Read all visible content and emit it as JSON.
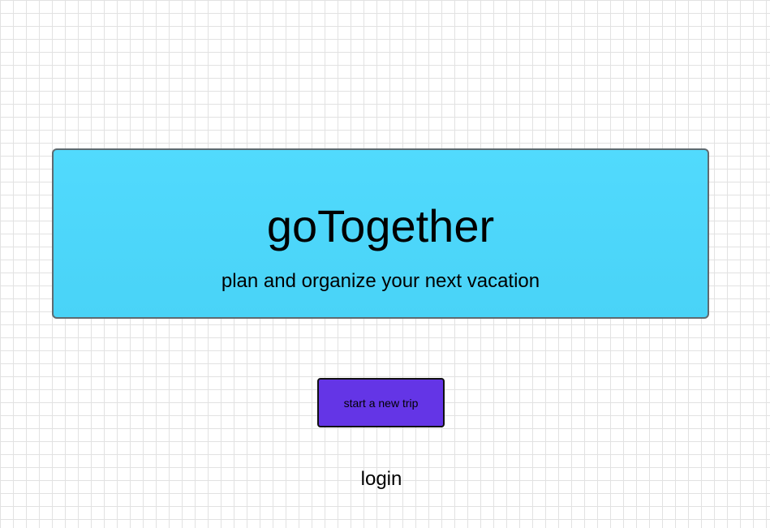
{
  "hero": {
    "title": "goTogether",
    "subtitle": "plan and organize your next vacation"
  },
  "actions": {
    "start_trip_label": "start a new trip",
    "login_label": "login"
  },
  "colors": {
    "hero_background": "#51dafd",
    "button_background": "#6435e6",
    "grid_line": "#e2e2e2"
  }
}
